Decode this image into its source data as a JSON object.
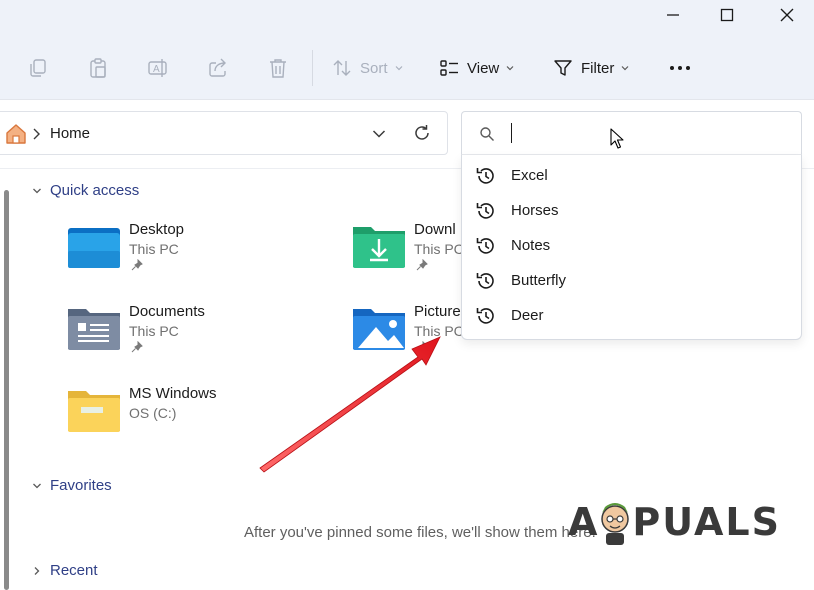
{
  "window": {
    "controls": [
      "minimize",
      "maximize",
      "close"
    ]
  },
  "toolbar": {
    "copy_icon": "copy-icon",
    "paste_icon": "paste-icon",
    "rename_icon": "rename-icon",
    "share_icon": "share-icon",
    "delete_icon": "delete-icon",
    "sort_label": "Sort",
    "view_label": "View",
    "filter_label": "Filter",
    "more_icon": "more-icon"
  },
  "address": {
    "location": "Home"
  },
  "search": {
    "value": "",
    "suggestions": [
      "Excel",
      "Horses",
      "Notes",
      "Butterfly",
      "Deer"
    ]
  },
  "quick_access": {
    "title": "Quick access",
    "items": [
      {
        "name": "Desktop",
        "location": "This PC",
        "pinned": true
      },
      {
        "name": "Downl",
        "location": "This PC",
        "pinned": true
      },
      {
        "name": "Documents",
        "location": "This PC",
        "pinned": true
      },
      {
        "name": "Picture",
        "location": "This PC",
        "pinned": true
      },
      {
        "name": "MS Windows",
        "location": "OS (C:)",
        "pinned": false
      }
    ]
  },
  "favorites": {
    "title": "Favorites",
    "empty_message": "After you've pinned some files, we'll show them here."
  },
  "recent": {
    "title": "Recent"
  },
  "watermark": {
    "logo_text_a": "A",
    "logo_text_rest": "PUALS"
  },
  "colors": {
    "toolbar_bg": "#eef2f9",
    "accent": "#1a6fd1",
    "arrow": "#e0141c",
    "section_text": "#2f3f86"
  }
}
